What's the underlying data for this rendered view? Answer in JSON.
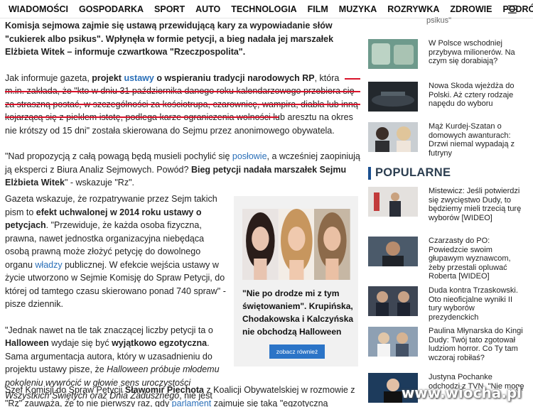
{
  "nav": {
    "items": [
      "WIADOMOŚCI",
      "GOSPODARKA",
      "SPORT",
      "AUTO",
      "TECHNOLOGIA",
      "FILM",
      "MUZYKA",
      "ROZRYWKA",
      "ZDROWIE",
      "PODRÓŻE"
    ],
    "menu_icon": "hamburger-icon"
  },
  "article": {
    "lead": "Komisja sejmowa zajmie się ustawą przewidującą kary za wypowiadanie słów \"cukierek albo psikus\". Wpłynęła w formie petycji, a bieg nadała jej marszałek Elżbieta Witek – informuje czwartkowa \"Rzeczpospolita\".",
    "p2_a": "Jak informuje gazeta, ",
    "p2_b": "projekt ",
    "p2_link": "ustawy",
    "p2_c": " o wspieraniu tradycji narodowych RP",
    "p2_d": ", która m.in. zakłada, że \"kto w dniu 31 października danego roku kalendarzowego przebiera się za straszną postać, w szczególności za kościotrupa, czarownicę, wampira, diabła lub inną kojarzącą się z piekłem istotę, podlega karze ograniczenia wolności lub aresztu na okres nie krótszy od 15 dni\" została skierowana do Sejmu przez anonimowego obywatela.",
    "p3_a": "\"Nad propozycją z całą powagą będą musieli pochylić się ",
    "p3_link": "posłowie",
    "p3_b": ", a wcześniej zaopiniują ją eksperci z Biura Analiz Sejmowych. Powód? ",
    "p3_bold": "Bieg petycji nadała marszałek Sejmu Elżbieta Witek",
    "p3_c": "\" - wskazuje \"Rz\".",
    "p4_a": "Gazeta wskazuje, że rozpatrywanie przez Sejm takich pism to ",
    "p4_bold": "efekt uchwalonej w 2014 roku ustawy o petycjach",
    "p4_b": ". \"Przewiduje, że każda osoba fizyczna, prawna, nawet jednostka organizacyjna niebędąca osobą prawną może złożyć petycję do dowolnego organu ",
    "p4_link": "władzy",
    "p4_c": " publicznej. W efekcie wejścia ustawy w życie utworzono w Sejmie Komisję do Spraw Petycji, do której od tamtego czasu skierowano ponad 740 spraw\" - pisze dziennik.",
    "p5_a": "\"Jednak nawet na tle tak znaczącej liczby petycji ta o ",
    "p5_bold1": "Halloween",
    "p5_b": " wydaje się być ",
    "p5_bold2": "wyjątkowo egzotyczna",
    "p5_c": ". Sama argumentacja autora, który w uzasadnieniu do projektu ustawy pisze, że ",
    "p5_ital": "Halloween próbuje młodemu pokoleniu wywrócić w głowie sens uroczystości Wszystkich Świętych oraz Dnia Zadusznego",
    "p5_d": ", nie jest nietypowa\" - czytamy.",
    "p6_a": "Szef Komisji do Spraw Petycji ",
    "p6_bold": "Sławomir Piechota",
    "p6_b": " z Koalicji Obywatelskiej w rozmowie z \"Rz\" zauważa, że to nie pierwszy raz, gdy ",
    "p6_link": "parlament",
    "p6_c": " zajmuje się taką \"egzotyczną petycją\"."
  },
  "promo": {
    "title": "\"Nie po drodze mi z tym świętowaniem\". Krupińska, Chodakowska i Kalczyńska nie obchodzą Halloween",
    "button": "zobacz również"
  },
  "sidebar": {
    "top_fragment": "psikus\"",
    "items": [
      {
        "text": "W Polsce wschodniej przybywa milionerów. Na czym się dorabiają?"
      },
      {
        "text": "Nowa Skoda wjeżdża do Polski. Aż cztery rodzaje napędu do wyboru"
      },
      {
        "text": "Mąż Kurdej-Szatan o domowych awanturach: Drzwi niemal wypadają z futryny"
      }
    ],
    "popular_heading": "POPULARNE",
    "popular": [
      {
        "text": "Mistewicz: Jeśli potwierdzi się zwycięstwo Dudy, to będziemy mieli trzecią turę wyborów [WIDEO]"
      },
      {
        "text": "Czarzasty do PO: Powiedzcie swoim głupawym wyznawcom, żeby przestali opluwać Roberta [WIDEO]"
      },
      {
        "text": "Duda kontra Trzaskowski. Oto nieoficjalne wyniki II tury wyborów prezydenckich"
      },
      {
        "text": "Paulina Młynarska do Kingi Dudy: Twój tato zgotował ludziom horror. Co Ty tam wczoraj robiłaś?"
      },
      {
        "text": "Justyna Pochanke odchodzi z TVN. \"Nie mogę się"
      }
    ]
  },
  "watermark": "www.wiocha.pl",
  "colors": {
    "link": "#2a6fb8",
    "underline": "#d9132a",
    "button": "#2b74c7",
    "popular_bar": "#1a4f8f"
  }
}
